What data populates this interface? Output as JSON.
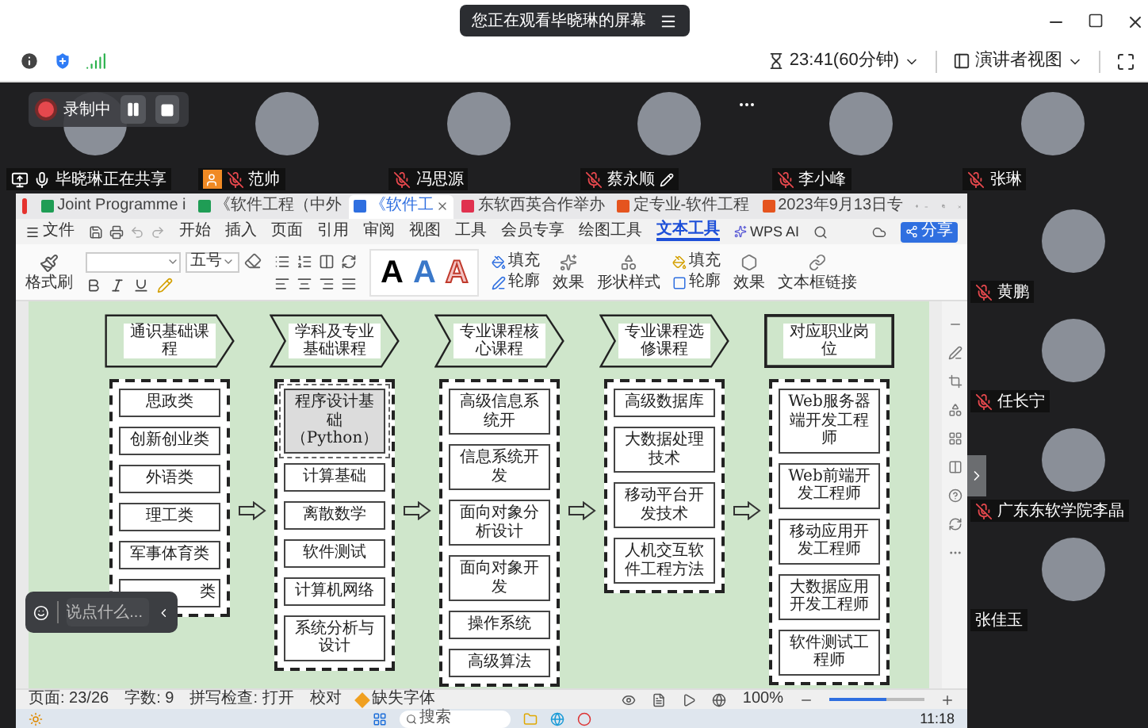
{
  "share_banner": {
    "text": "您正在观看毕晓琳的屏幕"
  },
  "meeting_info": {
    "timer": "23:41(60分钟)",
    "view": "演讲者视图"
  },
  "recording": {
    "label": "录制中"
  },
  "top_participants": [
    {
      "name": "毕晓琳正在共享",
      "muted": false,
      "sharing": true,
      "host": false,
      "annotating": false
    },
    {
      "name": "范帅",
      "muted": true,
      "sharing": false,
      "host": true,
      "annotating": false
    },
    {
      "name": "冯思源",
      "muted": true,
      "sharing": false,
      "host": false,
      "annotating": false
    },
    {
      "name": "蔡永顺",
      "muted": true,
      "sharing": false,
      "host": false,
      "annotating": true
    },
    {
      "name": "李小峰",
      "muted": true,
      "sharing": false,
      "host": false,
      "annotating": false
    },
    {
      "name": "张琳",
      "muted": true,
      "sharing": false,
      "host": false,
      "annotating": false
    }
  ],
  "side_participants": [
    {
      "name": "黄鹏",
      "muted": true
    },
    {
      "name": "任长宁",
      "muted": true
    },
    {
      "name": "广东东软学院李晶",
      "muted": true
    },
    {
      "name": "张佳玉",
      "muted": false
    }
  ],
  "wps": {
    "tabs": [
      {
        "label": "Joint Programme i",
        "kind": "sheet",
        "selected": false
      },
      {
        "label": "《软件工程（中外",
        "kind": "sheet",
        "selected": false
      },
      {
        "label": "《软件工",
        "kind": "doc",
        "selected": true
      },
      {
        "label": "东软西英合作举办",
        "kind": "pdf",
        "selected": false
      },
      {
        "label": "定专业-软件工程",
        "kind": "ppt",
        "selected": false
      },
      {
        "label": "2023年9月13日专",
        "kind": "ppt",
        "selected": false
      }
    ],
    "file_menu": "文件",
    "menu": [
      {
        "label": "开始",
        "selected": false
      },
      {
        "label": "插入",
        "selected": false
      },
      {
        "label": "页面",
        "selected": false
      },
      {
        "label": "引用",
        "selected": false
      },
      {
        "label": "审阅",
        "selected": false
      },
      {
        "label": "视图",
        "selected": false
      },
      {
        "label": "工具",
        "selected": false
      },
      {
        "label": "会员专享",
        "selected": false
      },
      {
        "label": "绘图工具",
        "selected": false
      },
      {
        "label": "文本工具",
        "selected": true
      }
    ],
    "ai_label": "WPS AI",
    "share_button": "分享",
    "ribbon": {
      "format_painter": "格式刷",
      "font_size": "五号",
      "style_letters": [
        "A",
        "A",
        "A"
      ],
      "text_fill": "填充",
      "text_outline": "轮廓",
      "text_effect": "效果",
      "shape_style": "形状样式",
      "shape_fill": "填充",
      "shape_outline": "轮廓",
      "shape_effect": "效果",
      "text_box_link": "文本框链接"
    },
    "diagram": [
      {
        "heading": "通识基础课程",
        "kind": "pentagon",
        "items": [
          {
            "text": "思政类",
            "selected": false,
            "partly_covered": false
          },
          {
            "text": "创新创业类",
            "selected": false,
            "partly_covered": false
          },
          {
            "text": "外语类",
            "selected": false,
            "partly_covered": false
          },
          {
            "text": "理工类",
            "selected": false,
            "partly_covered": false
          },
          {
            "text": "军事体育类",
            "selected": false,
            "partly_covered": false
          },
          {
            "text": "类",
            "selected": false,
            "partly_covered": true
          }
        ]
      },
      {
        "heading": "学科及专业基础课程",
        "kind": "chevron",
        "items": [
          {
            "text": "程序设计基础（Python）",
            "selected": true,
            "partly_covered": false
          },
          {
            "text": "计算基础",
            "selected": false,
            "partly_covered": false
          },
          {
            "text": "离散数学",
            "selected": false,
            "partly_covered": false
          },
          {
            "text": "软件测试",
            "selected": false,
            "partly_covered": false
          },
          {
            "text": "计算机网络",
            "selected": false,
            "partly_covered": false
          },
          {
            "text": "系统分析与设计",
            "selected": false,
            "partly_covered": false
          }
        ]
      },
      {
        "heading": "专业课程核心课程",
        "kind": "chevron",
        "items": [
          {
            "text": "高级信息系统开",
            "selected": false,
            "partly_covered": false
          },
          {
            "text": "信息系统开发",
            "selected": false,
            "partly_covered": false
          },
          {
            "text": "面向对象分析设计",
            "selected": false,
            "partly_covered": false
          },
          {
            "text": "面向对象开发",
            "selected": false,
            "partly_covered": false
          },
          {
            "text": "操作系统",
            "selected": false,
            "partly_covered": false
          },
          {
            "text": "高级算法",
            "selected": false,
            "partly_covered": false
          }
        ]
      },
      {
        "heading": "专业课程选修课程",
        "kind": "chevron",
        "items": [
          {
            "text": "高级数据库",
            "selected": false,
            "partly_covered": false
          },
          {
            "text": "大数据处理技术",
            "selected": false,
            "partly_covered": false
          },
          {
            "text": "移动平台开发技术",
            "selected": false,
            "partly_covered": false
          },
          {
            "text": "人机交互软件工程方法",
            "selected": false,
            "partly_covered": false
          }
        ]
      },
      {
        "heading": "对应职业岗位",
        "kind": "rect",
        "items": [
          {
            "text": "Web服务器端开发工程师",
            "selected": false,
            "partly_covered": false
          },
          {
            "text": "Web前端开发工程师",
            "selected": false,
            "partly_covered": false
          },
          {
            "text": "移动应用开发工程师",
            "selected": false,
            "partly_covered": false
          },
          {
            "text": "大数据应用开发工程师",
            "selected": false,
            "partly_covered": false
          },
          {
            "text": "软件测试工程师",
            "selected": false,
            "partly_covered": false
          }
        ]
      }
    ],
    "status_bar": {
      "page": "页面: 23/26",
      "words": "字数: 9",
      "spell": "拼写检查: 打开",
      "proof": "校对",
      "missing_fonts": "缺失字体",
      "zoom": "100%",
      "zoom_slider": {
        "level": 0.6
      }
    },
    "taskbar": {
      "search": "搜索",
      "time": "11:18"
    }
  },
  "chat": {
    "placeholder": "说点什么..."
  }
}
